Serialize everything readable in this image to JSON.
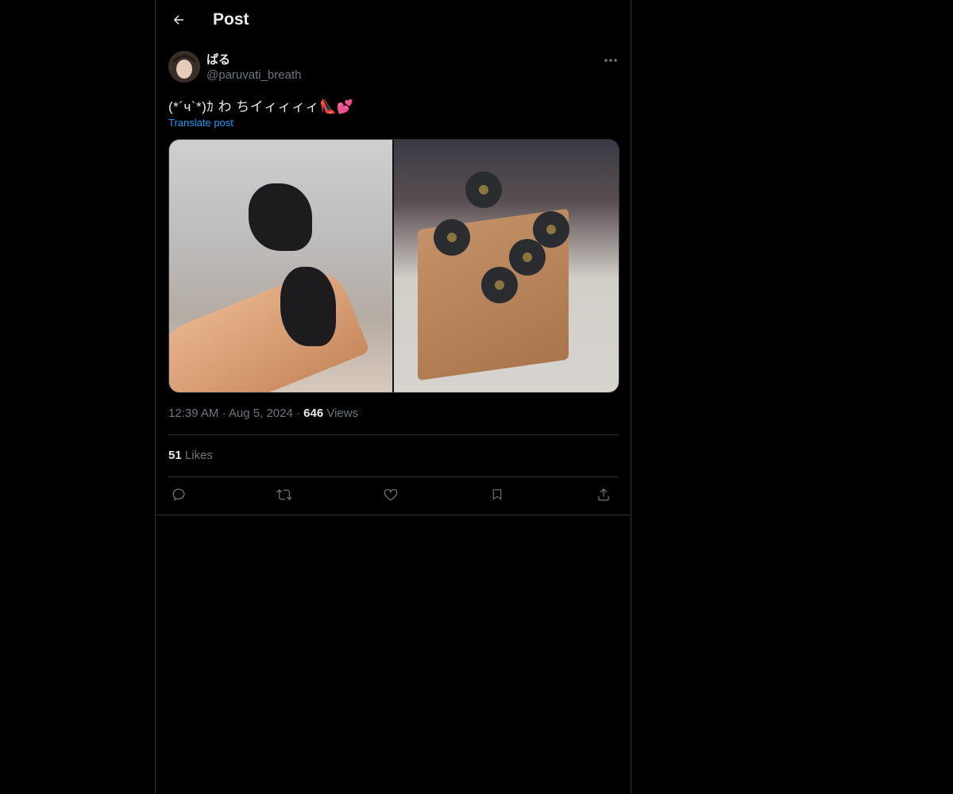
{
  "header": {
    "title": "Post",
    "back_icon": "arrow-left-icon"
  },
  "author": {
    "display_name": "ぱる",
    "handle": "@paruvati_breath",
    "more_icon": "more-horizontal-icon"
  },
  "post": {
    "text": "(*´ч`*)ｶ わ ちイィィィィ👠💕",
    "translate_label": "Translate post",
    "time": "12:39 AM",
    "date": "Aug 5, 2024",
    "views_count": "646",
    "views_label": "Views",
    "separator": "·",
    "likes_count": "51",
    "likes_label": "Likes"
  },
  "actions": {
    "reply_icon": "reply-icon",
    "repost_icon": "repost-icon",
    "like_icon": "heart-icon",
    "bookmark_icon": "bookmark-icon",
    "share_icon": "share-icon"
  },
  "colors": {
    "background": "#000000",
    "text_primary": "#e7e9ea",
    "text_secondary": "#71767b",
    "link": "#1d9bf0",
    "border": "#2f3336"
  }
}
